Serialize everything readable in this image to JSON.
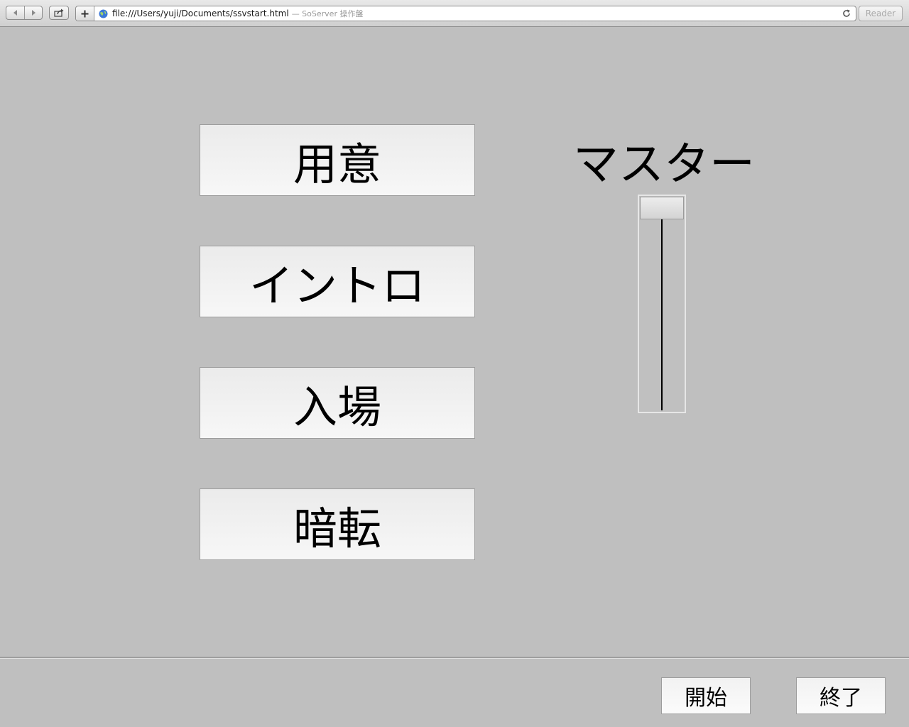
{
  "browser": {
    "url": "file:///Users/yuji/Documents/ssvstart.html",
    "page_title": "— SoServer 操作盤",
    "reader_label": "Reader",
    "icons": {
      "back": "arrow-left-icon",
      "forward": "arrow-right-icon",
      "share": "share-icon",
      "add": "plus-icon",
      "site": "globe-icon",
      "reload": "reload-icon"
    }
  },
  "cues": [
    {
      "label": "用意"
    },
    {
      "label": "イントロ"
    },
    {
      "label": "入場"
    },
    {
      "label": "暗転"
    }
  ],
  "master": {
    "label": "マスター",
    "level": 1.0
  },
  "controls": {
    "start_label": "開始",
    "stop_label": "終了"
  }
}
